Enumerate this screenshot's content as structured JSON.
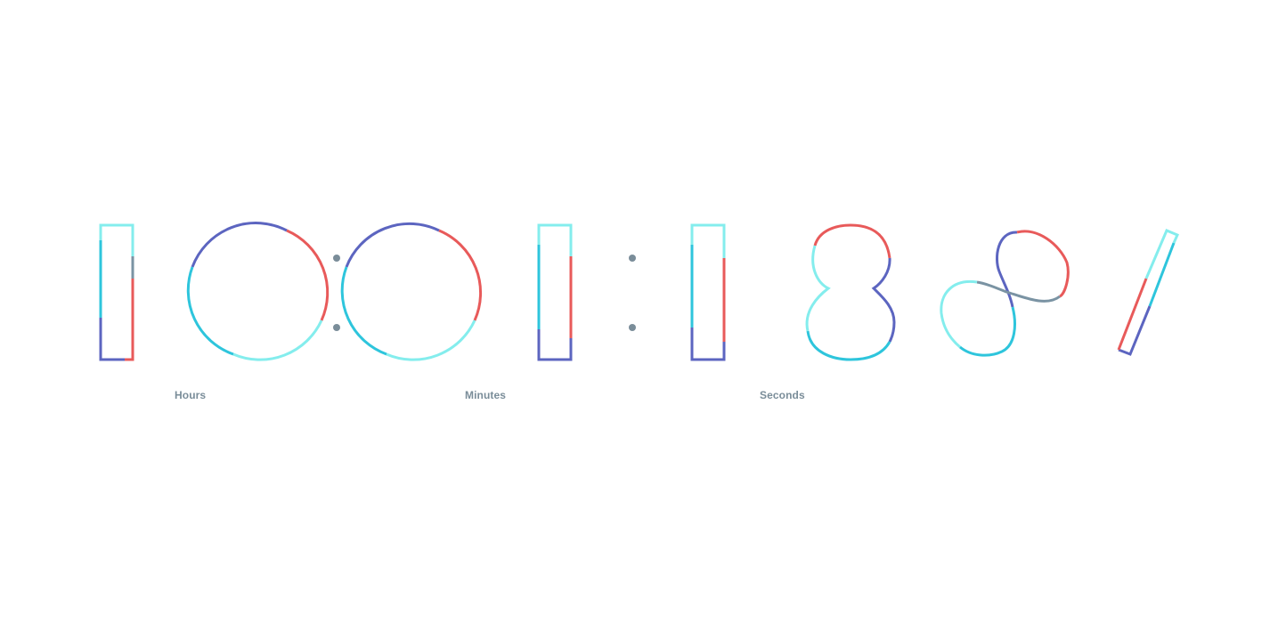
{
  "clock": {
    "digits": [
      "1",
      "0",
      "0",
      "1",
      "1",
      "8",
      "8",
      "7"
    ],
    "separators": [
      ":",
      ":"
    ],
    "labels": {
      "hours": "Hours",
      "minutes": "Minutes",
      "seconds": "Seconds"
    }
  },
  "colors": {
    "background": "#ffffff",
    "label_text": "#7a8d99",
    "separator_dot": "#7a8d99",
    "stroke_light_cyan": "#84eded",
    "stroke_cyan": "#2ec5dc",
    "stroke_indigo": "#5c65c0",
    "stroke_red": "#e85a5a",
    "stroke_slate": "#7a93a3"
  }
}
